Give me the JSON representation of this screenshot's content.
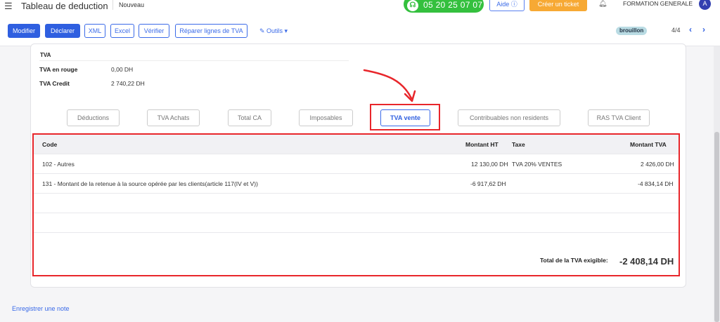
{
  "topbar": {
    "hamburger_icon": "menu-icon",
    "title": "Tableau de deduction",
    "status": "Nouveau",
    "phone_icon": "headset-icon",
    "phone": "05 20 25 07 07",
    "help": "Aide ⓘ",
    "ticket": "Créer un ticket",
    "bell_icon": "bell-icon",
    "company": "FORMATION GENERALE",
    "avatar": "A",
    "colors": {
      "phone_green": "#34c03e",
      "ticket_orange": "#f7a934",
      "avatar": "#3340b0"
    }
  },
  "toolbar": {
    "modify": "Modifier",
    "declare": "Déclarer",
    "xml": "XML",
    "excel": "Excel",
    "verify": "Vérifier",
    "repair": "Réparer lignes de TVA",
    "tools": "✎ Outils ▾",
    "badge": "brouillon",
    "pager": "4/4",
    "prev_icon": "chevron-left-icon",
    "next_icon": "chevron-right-icon",
    "accent": "#2f5fe0"
  },
  "summary": {
    "heading": "TVA",
    "rows": [
      {
        "label": "TVA en rouge",
        "value": "0,00 DH"
      },
      {
        "label": "TVA Credit",
        "value": "2 740,22 DH"
      }
    ]
  },
  "tabs": [
    {
      "label": "Déductions",
      "active": false
    },
    {
      "label": "TVA Achats",
      "active": false
    },
    {
      "label": "Total CA",
      "active": false
    },
    {
      "label": "Imposables",
      "active": false
    },
    {
      "label": "TVA vente",
      "active": true
    },
    {
      "label": "Contribuables non residents",
      "active": false
    },
    {
      "label": "RAS TVA Client",
      "active": false
    }
  ],
  "table": {
    "headers": {
      "code": "Code",
      "montant_ht": "Montant HT",
      "taxe": "Taxe",
      "montant_tva": "Montant TVA"
    },
    "rows": [
      {
        "code": "102 - Autres",
        "montant_ht": "12 130,00 DH",
        "taxe": "TVA 20% VENTES",
        "montant_tva": "2 426,00 DH"
      },
      {
        "code": "131 - Montant de la retenue à la source opérée par les clients(article 117(IV et V))",
        "montant_ht": "-6 917,62 DH",
        "taxe": "",
        "montant_tva": "-4 834,14 DH"
      }
    ],
    "total_label": "Total de la TVA exigible:",
    "total_value": "-2 408,14 DH"
  },
  "annotation_color": "#e8262b",
  "footer": {
    "note_link": "Enregistrer une note"
  }
}
